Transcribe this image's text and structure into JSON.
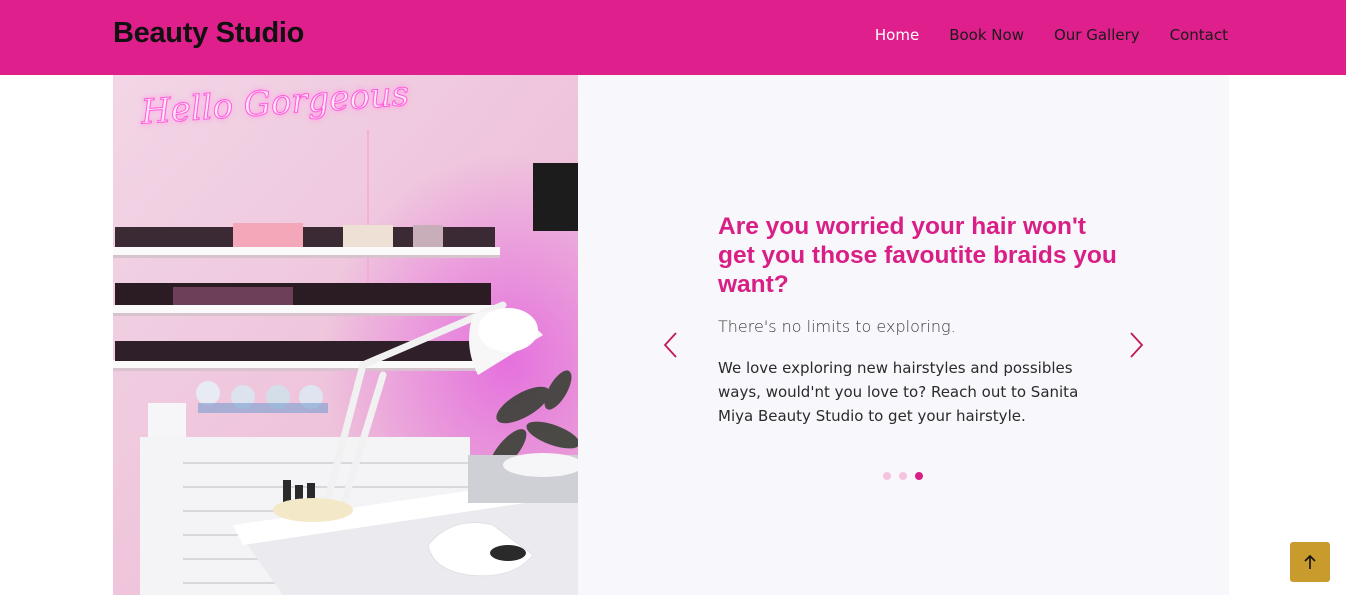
{
  "brand": {
    "name": "Beauty Studio"
  },
  "nav": {
    "items": [
      {
        "label": "Home",
        "active": true
      },
      {
        "label": "Book Now",
        "active": false
      },
      {
        "label": "Our Gallery",
        "active": false
      },
      {
        "label": "Contact",
        "active": false
      }
    ]
  },
  "hero_image": {
    "neon_text": "Hello Gorgeous"
  },
  "carousel": {
    "title": "Are you worried your hair won't get you those favoutite braids you want?",
    "subtitle": "There's no limits to exploring.",
    "body": "We love exploring new hairstyles and possibles ways, would'nt you love to? Reach out to Sanita Miya Beauty Studio to get your hairstyle.",
    "prev_icon": "chevron-left-icon",
    "next_icon": "chevron-right-icon",
    "slide_count": 3,
    "active_slide": 3
  },
  "scroll_top": {
    "icon": "arrow-up-icon"
  },
  "colors": {
    "navbar": "#df1f8b",
    "accent": "#d91f85",
    "panel_bg": "#f7f7fc",
    "scroll_top_bg": "#c89b2c"
  }
}
